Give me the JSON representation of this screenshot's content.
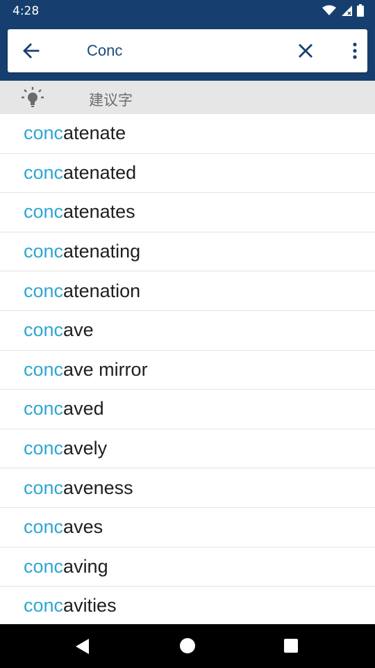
{
  "status_bar": {
    "time": "4:28",
    "icons": [
      "wifi-icon",
      "cell-signal-icon",
      "battery-icon"
    ]
  },
  "search": {
    "query": "Conc",
    "back_icon": "arrow-back-icon",
    "clear_icon": "close-icon",
    "more_icon": "more-vert-icon"
  },
  "suggestions_header": {
    "icon": "lightbulb-icon",
    "label": "建议字"
  },
  "words": [
    {
      "prefix": "conc",
      "rest": "atenate"
    },
    {
      "prefix": "conc",
      "rest": "atenated"
    },
    {
      "prefix": "conc",
      "rest": "atenates"
    },
    {
      "prefix": "conc",
      "rest": "atenating"
    },
    {
      "prefix": "conc",
      "rest": "atenation"
    },
    {
      "prefix": "conc",
      "rest": "ave"
    },
    {
      "prefix": "conc",
      "rest": "ave mirror"
    },
    {
      "prefix": "conc",
      "rest": "aved"
    },
    {
      "prefix": "conc",
      "rest": "avely"
    },
    {
      "prefix": "conc",
      "rest": "aveness"
    },
    {
      "prefix": "conc",
      "rest": "aves"
    },
    {
      "prefix": "conc",
      "rest": "aving"
    },
    {
      "prefix": "conc",
      "rest": "avities"
    }
  ],
  "colors": {
    "app_bar": "#163f6f",
    "highlight": "#2ea6d3",
    "header_bg": "#e6e6e6"
  },
  "nav_bar": {
    "icons": [
      "nav-back-icon",
      "nav-home-icon",
      "nav-recents-icon"
    ]
  }
}
